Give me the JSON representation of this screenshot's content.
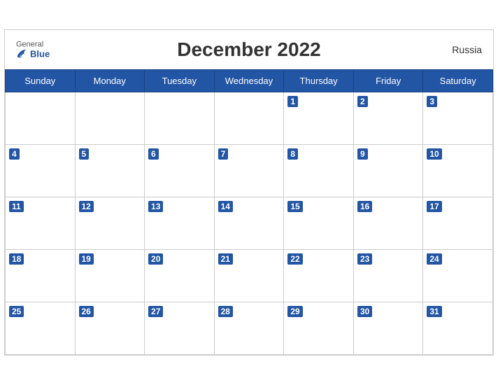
{
  "header": {
    "logo_general": "General",
    "logo_blue": "Blue",
    "title": "December 2022",
    "country": "Russia"
  },
  "weekdays": [
    "Sunday",
    "Monday",
    "Tuesday",
    "Wednesday",
    "Thursday",
    "Friday",
    "Saturday"
  ],
  "weeks": [
    [
      null,
      null,
      null,
      null,
      1,
      2,
      3
    ],
    [
      4,
      5,
      6,
      7,
      8,
      9,
      10
    ],
    [
      11,
      12,
      13,
      14,
      15,
      16,
      17
    ],
    [
      18,
      19,
      20,
      21,
      22,
      23,
      24
    ],
    [
      25,
      26,
      27,
      28,
      29,
      30,
      31
    ]
  ]
}
